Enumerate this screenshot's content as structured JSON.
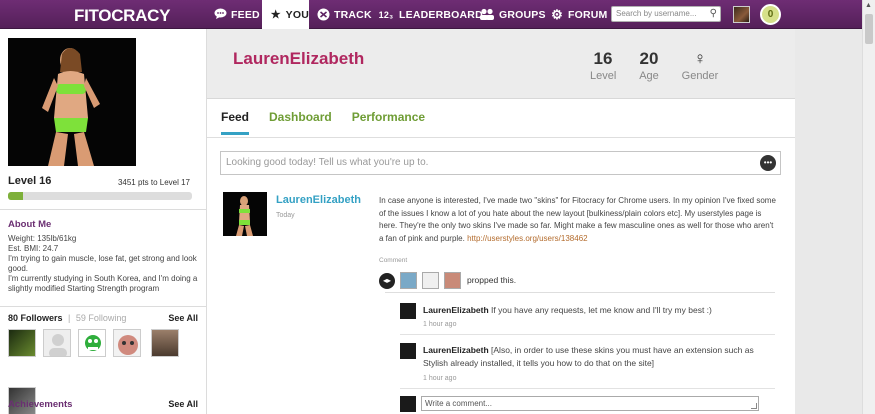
{
  "topnav": {
    "logo": "FITOCRACY",
    "items": [
      {
        "label": "FEED",
        "icon": "speech-bubble-icon"
      },
      {
        "label": "YOU",
        "icon": "star-icon"
      },
      {
        "label": "TRACK",
        "icon": "track-icon"
      },
      {
        "label": "LEADERBOARD",
        "icon": "leaderboard-icon"
      },
      {
        "label": "GROUPS",
        "icon": "groups-icon"
      },
      {
        "label": "FORUM",
        "icon": "gear-icon"
      }
    ],
    "search_placeholder": "Search by username...",
    "badge_count": "0"
  },
  "sidebar": {
    "level": "Level 16",
    "pts_to_next": "3451 pts to Level 17",
    "level_progress": 0.08,
    "about_title": "About Me",
    "about_lines": [
      "Weight: 135lb/61kg",
      "Est. BMI: 24.7",
      "I'm trying to gain muscle, lose fat, get strong and look good.",
      "I'm currently studying in South Korea, and I'm doing a slightly modified Starting Strength program"
    ],
    "followers_count": "80 Followers",
    "following_count": "59 Following",
    "separator": "|",
    "see_all": "See All",
    "achievements_title": "Achievements"
  },
  "profile": {
    "username": "LaurenElizabeth",
    "stats": [
      {
        "value": "16",
        "label": "Level"
      },
      {
        "value": "20",
        "label": "Age"
      },
      {
        "value": "♀",
        "label": "Gender"
      }
    ]
  },
  "tabs": [
    {
      "label": "Feed",
      "active": true
    },
    {
      "label": "Dashboard",
      "active": false
    },
    {
      "label": "Performance",
      "active": false
    }
  ],
  "status_placeholder": "Looking good today! Tell us what you're up to.",
  "post": {
    "user": "LaurenElizabeth",
    "time": "Today",
    "body": "In case anyone is interested, I've made two \"skins\" for Fitocracy for Chrome users. In my opinion I've fixed some of the issues I know a lot of you hate about the new layout [bulkiness/plain colors etc]. My userstyles page is here. They're the only two skins I've made so far. Might make a few masculine ones as well for those who aren't a fan of pink and purple.",
    "link": "http://userstyles.org/users/138462",
    "comment_label": "Comment",
    "propped_text": "propped this."
  },
  "comments": [
    {
      "user": "LaurenElizabeth",
      "text": "If you have any requests, let me know and I'll try my best :)",
      "time": "1 hour ago"
    },
    {
      "user": "LaurenElizabeth",
      "text": "[Also, in order to use these skins you must have an extension such as Stylish already installed, it tells you how to do that on the site]",
      "time": "1 hour ago"
    }
  ],
  "write_comment": "Write a comment...",
  "colors": {
    "brand_purple": "#5e2463",
    "username_pink": "#b0275f",
    "tab_green": "#6f9d35",
    "link_blue": "#34a1c4"
  }
}
